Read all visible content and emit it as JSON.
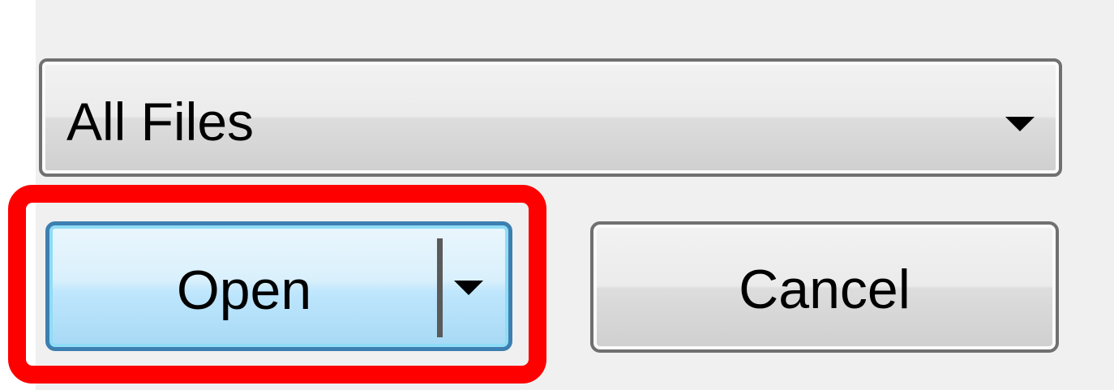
{
  "file_type_filter": {
    "selected": "All Files",
    "icon": "chevron-down-icon"
  },
  "buttons": {
    "open_label": "Open",
    "open_dropdown_icon": "chevron-down-icon",
    "cancel_label": "Cancel"
  },
  "colors": {
    "highlight": "#ff0000",
    "open_button_border": "#3c7fb1",
    "open_button_fill": "#bee6fd",
    "default_button_border": "#707070",
    "panel_background": "#f0f0f0"
  }
}
